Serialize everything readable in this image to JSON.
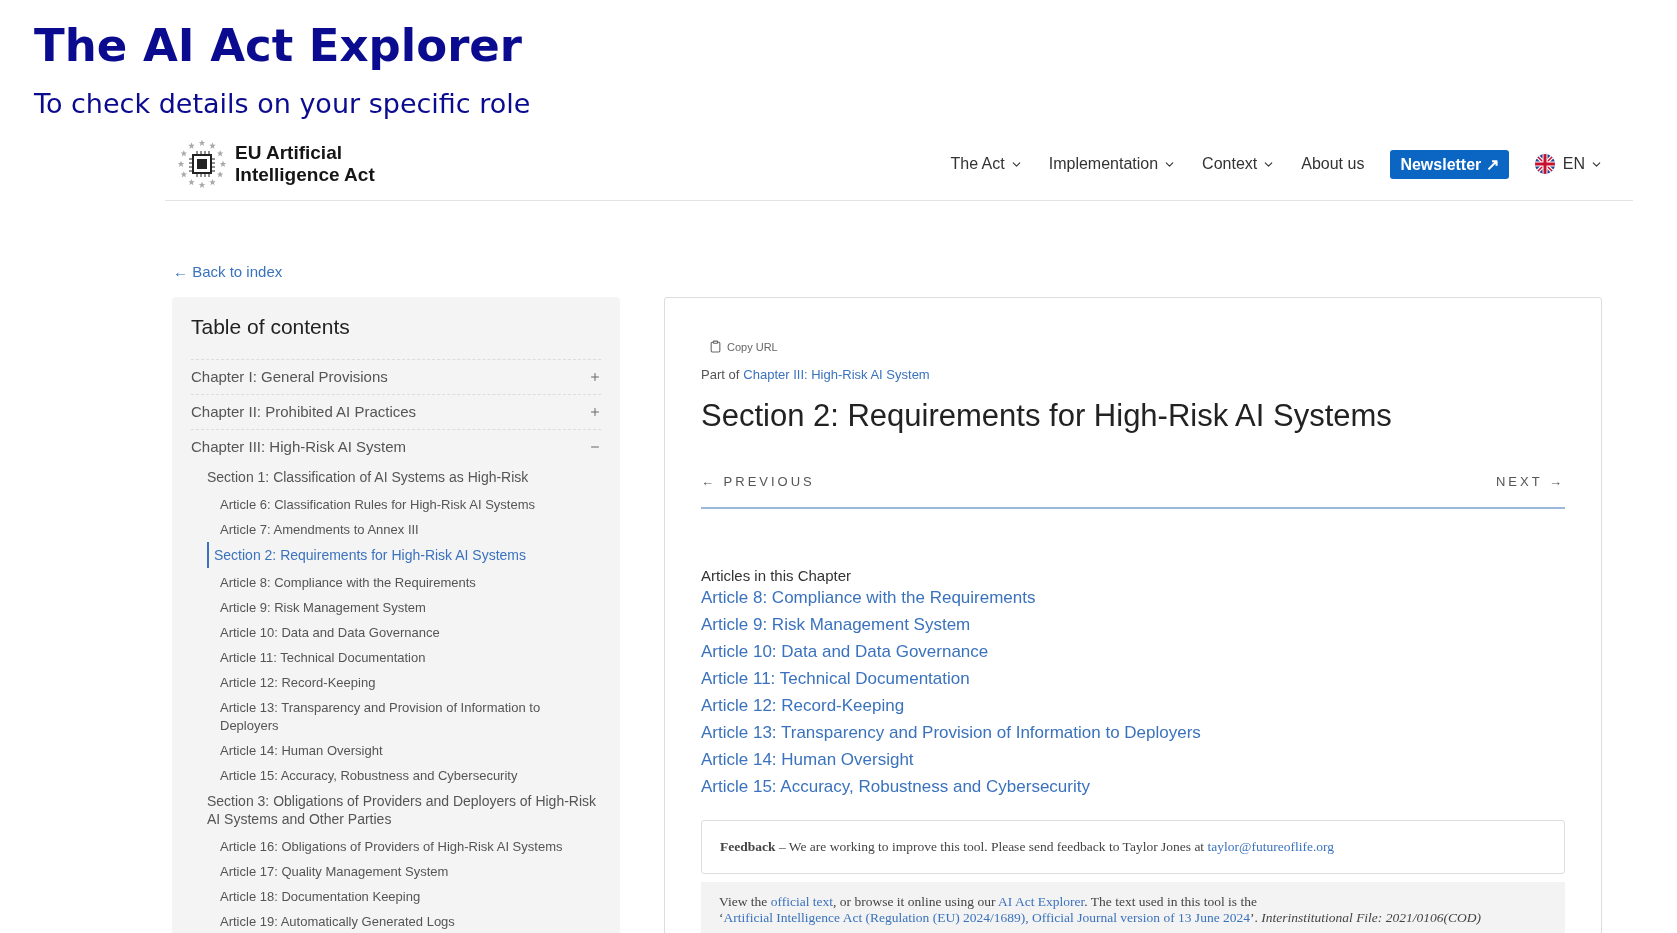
{
  "slide": {
    "title": "The AI Act Explorer",
    "subtitle": "To check details on your specific role"
  },
  "site": {
    "logo_text": "EU Artificial Intelligence Act",
    "nav": [
      {
        "label": "The Act",
        "kind": "menu"
      },
      {
        "label": "Implementation",
        "kind": "menu"
      },
      {
        "label": "Context",
        "kind": "menu"
      },
      {
        "label": "About us",
        "kind": "link"
      },
      {
        "label": "Newsletter ↗",
        "kind": "button"
      }
    ],
    "language": "EN"
  },
  "back_link": "← Back to index",
  "toc": {
    "title": "Table of contents",
    "chapters": [
      {
        "label": "Chapter I: General Provisions",
        "expanded": false
      },
      {
        "label": "Chapter II: Prohibited AI Practices",
        "expanded": false
      },
      {
        "label": "Chapter III: High-Risk AI System",
        "expanded": true,
        "children": [
          {
            "label": "Section 1: Classification of AI Systems as High-Risk",
            "selected": false,
            "children": [
              {
                "label": "Article 6: Classification Rules for High-Risk AI Systems"
              },
              {
                "label": "Article 7: Amendments to Annex III"
              }
            ]
          },
          {
            "label": "Section 2: Requirements for High-Risk AI Systems",
            "selected": true,
            "children": [
              {
                "label": "Article 8: Compliance with the Requirements"
              },
              {
                "label": "Article 9: Risk Management System"
              },
              {
                "label": "Article 10: Data and Data Governance"
              },
              {
                "label": "Article 11: Technical Documentation"
              },
              {
                "label": "Article 12: Record-Keeping"
              },
              {
                "label": "Article 13: Transparency and Provision of Information to Deployers"
              },
              {
                "label": "Article 14: Human Oversight"
              },
              {
                "label": "Article 15: Accuracy, Robustness and Cybersecurity"
              }
            ]
          },
          {
            "label": "Section 3: Obligations of Providers and Deployers of High-Risk AI Systems and Other Parties",
            "selected": false,
            "children": [
              {
                "label": "Article 16: Obligations of Providers of High-Risk AI Systems"
              },
              {
                "label": "Article 17: Quality Management System"
              },
              {
                "label": "Article 18: Documentation Keeping"
              },
              {
                "label": "Article 19: Automatically Generated Logs"
              }
            ]
          }
        ]
      }
    ]
  },
  "content": {
    "copy_url": "Copy URL",
    "part_of_label": "Part of",
    "part_of_link": "Chapter III: High-Risk AI System",
    "heading": "Section 2: Requirements for High-Risk AI Systems",
    "previous": "← PREVIOUS",
    "next": "NEXT →",
    "articles_label": "Articles in this Chapter",
    "articles": [
      "Article 8: Compliance with the Requirements",
      "Article 9: Risk Management System",
      "Article 10: Data and Data Governance",
      "Article 11: Technical Documentation",
      "Article 12: Record-Keeping",
      "Article 13: Transparency and Provision of Information to Deployers",
      "Article 14: Human Oversight",
      "Article 15: Accuracy, Robustness and Cybersecurity"
    ],
    "feedback": [
      {
        "kind": "bold",
        "text": "Feedback"
      },
      {
        "kind": "plain",
        "text": " – We are working to improve this tool. Please send feedback to Taylor Jones at "
      },
      {
        "kind": "link",
        "text": "taylor@futureoflife.org"
      }
    ],
    "notice": [
      {
        "kind": "plain",
        "text": "View the "
      },
      {
        "kind": "link",
        "text": "official text"
      },
      {
        "kind": "plain",
        "text": ", or browse it online using our "
      },
      {
        "kind": "link",
        "text": "AI Act Explorer"
      },
      {
        "kind": "plain",
        "text": ". The text used in this tool is the ‘"
      },
      {
        "kind": "link",
        "text": "Artificial Intelligence Act (Regulation (EU) 2024/1689), Official Journal version of 13 June 2024"
      },
      {
        "kind": "plain",
        "text": "’. "
      },
      {
        "kind": "italic",
        "text": "Interinstitutional File: 2021/0106(COD)"
      }
    ]
  }
}
